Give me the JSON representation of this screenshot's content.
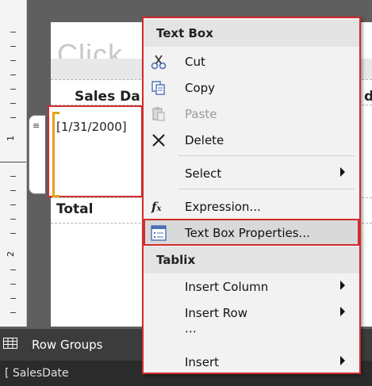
{
  "report": {
    "title_fragment": "Click",
    "column_header": "Sales Da",
    "column_header_partial": "du",
    "date_value": "[1/31/2000]",
    "total_label": "Total"
  },
  "ruler": {
    "labels": [
      "1",
      "2"
    ]
  },
  "bottom": {
    "row_groups_label": "Row Groups",
    "group_item": "SalesDate"
  },
  "context_menu": {
    "text_box_header": "Text Box",
    "cut": "Cut",
    "copy": "Copy",
    "paste": "Paste",
    "delete": "Delete",
    "select": "Select",
    "expression": "Expression...",
    "text_box_properties": "Text Box Properties...",
    "tablix_header": "Tablix",
    "insert_column": "Insert Column",
    "insert_row": "Insert Row",
    "ellipsis": "⋯",
    "insert": "Insert"
  },
  "colors": {
    "highlight": "#d42b2b",
    "bracket": "#e2a418"
  }
}
